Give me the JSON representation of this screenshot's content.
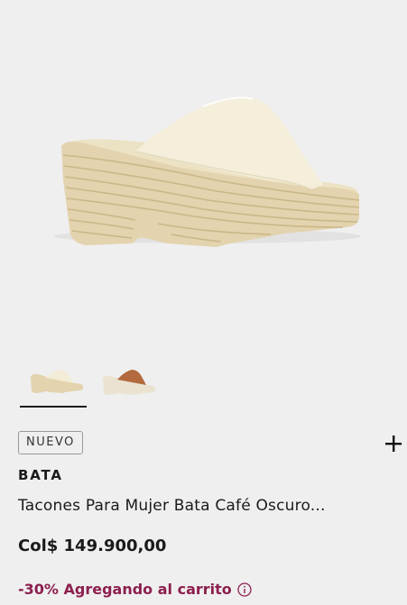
{
  "product": {
    "badge": "NUEVO",
    "brand": "BATA",
    "title": "Tacones Para Mujer Bata Café Oscuro...",
    "price": "Col$ 149.900,00",
    "promo": "-30% Agregando al carrito",
    "add_icon": "plus-icon",
    "info_icon": "info-icon"
  },
  "thumbnails": [
    {
      "color_name": "cream",
      "color": "#f3ecd6",
      "selected": true
    },
    {
      "color_name": "brown",
      "color": "#b36a3e",
      "selected": false
    }
  ],
  "colors": {
    "background": "#efefef",
    "shoe_upper": "#f4eedb",
    "jute": "#e3d3ae",
    "promo": "#8c1f4e"
  }
}
